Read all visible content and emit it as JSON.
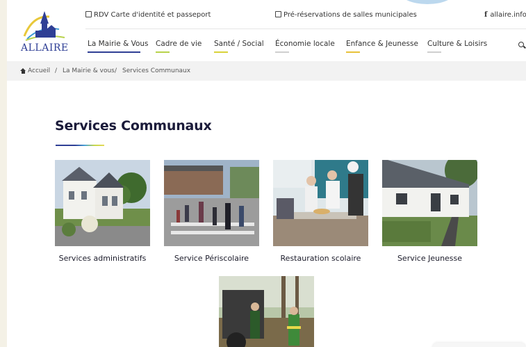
{
  "site": {
    "logo_text": "ALLAIRE"
  },
  "topbar": {
    "rdv": "RDV Carte d'identité et passeport",
    "reservations": "Pré-réservations de salles municipales",
    "facebook": "allaire.info"
  },
  "nav": [
    {
      "label": "La Mairie & Vous",
      "active": true,
      "color": "#2f3f95"
    },
    {
      "label": "Cadre de vie",
      "color": "#b8d24b"
    },
    {
      "label": "Santé / Social",
      "color": "#d9d23a"
    },
    {
      "label": "Économie locale",
      "color": "#cfcfcf"
    },
    {
      "label": "Enfance & Jeunesse",
      "color": "#e8c23a"
    },
    {
      "label": "Culture & Loisirs",
      "color": "#cfcfcf"
    }
  ],
  "breadcrumb": {
    "home": "Accueil",
    "sep": "/",
    "parent": "La Mairie & vous",
    "current": "Services Communaux"
  },
  "page": {
    "title": "Services Communaux"
  },
  "cards": [
    {
      "label": "Services administratifs",
      "image": "town-hall-photo"
    },
    {
      "label": "Service Périscolaire",
      "image": "school-crossing-photo"
    },
    {
      "label": "Restauration scolaire",
      "image": "school-canteen-photo"
    },
    {
      "label": "Service Jeunesse",
      "image": "youth-building-photo"
    },
    {
      "label": "",
      "image": "technical-workers-photo"
    }
  ],
  "colors": {
    "brand": "#2f3f95",
    "accent_green": "#b8d24b",
    "accent_yellow": "#e4d95a",
    "accent_blue": "#4aa3d8"
  }
}
